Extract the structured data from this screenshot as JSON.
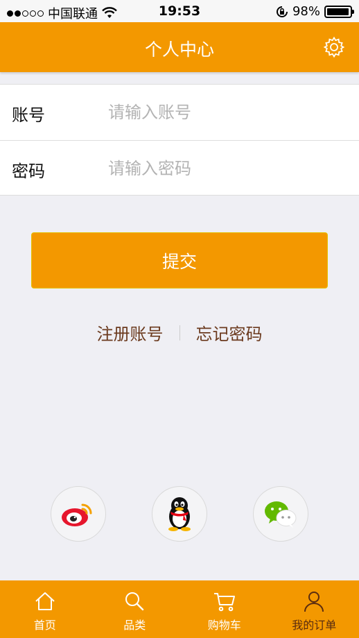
{
  "status_bar": {
    "carrier": "中国联通",
    "time": "19:53",
    "battery": "98%",
    "battery_level": 0.98
  },
  "nav": {
    "title": "个人中心",
    "settings_icon": "gear-icon"
  },
  "form": {
    "account_label": "账号",
    "account_placeholder": "请输入账号",
    "account_value": "",
    "password_label": "密码",
    "password_placeholder": "请输入密码",
    "password_value": ""
  },
  "submit_label": "提交",
  "links": {
    "register": "注册账号",
    "forgot": "忘记密码"
  },
  "social": [
    {
      "name": "weibo",
      "icon": "weibo-icon"
    },
    {
      "name": "qq",
      "icon": "qq-penguin-icon"
    },
    {
      "name": "wechat",
      "icon": "wechat-icon"
    }
  ],
  "tabs": [
    {
      "label": "首页",
      "icon": "home-icon",
      "active": false
    },
    {
      "label": "品类",
      "icon": "search-icon",
      "active": false
    },
    {
      "label": "购物车",
      "icon": "cart-icon",
      "active": false
    },
    {
      "label": "我的订单",
      "icon": "user-icon",
      "active": true
    }
  ],
  "colors": {
    "accent": "#f39800",
    "active_tab": "#5a2c10",
    "link": "#6b3a1e",
    "background": "#efeff4"
  }
}
